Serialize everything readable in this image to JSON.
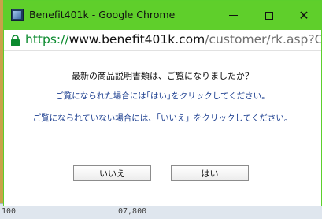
{
  "window": {
    "title": "Benefit401k - Google Chrome",
    "frame_color": "#5fcf2b",
    "app_icon": "chrome-app-icon",
    "controls": {
      "minimize": "minimize-icon",
      "maximize": "maximize-icon",
      "close_glyph": "✕"
    }
  },
  "address_bar": {
    "scheme": "https://",
    "domain": "www.benefit401k.com",
    "path": "/customer/rk.asp?Categ",
    "secure_icon": "lock-icon"
  },
  "dialog": {
    "question": "最新の商品説明書類は、ご覧になりましたか？",
    "yes_instruction": "ご覧になられた場合には｢はい｣をクリックしてください。",
    "no_instruction": "ご覧になられていない場合には、「いいえ」をクリックしてください。",
    "no_button": "いいえ",
    "yes_button": "はい",
    "text_color": "#1a3d8f"
  },
  "background_page": {
    "fragments": [
      "100",
      "07,800"
    ]
  }
}
